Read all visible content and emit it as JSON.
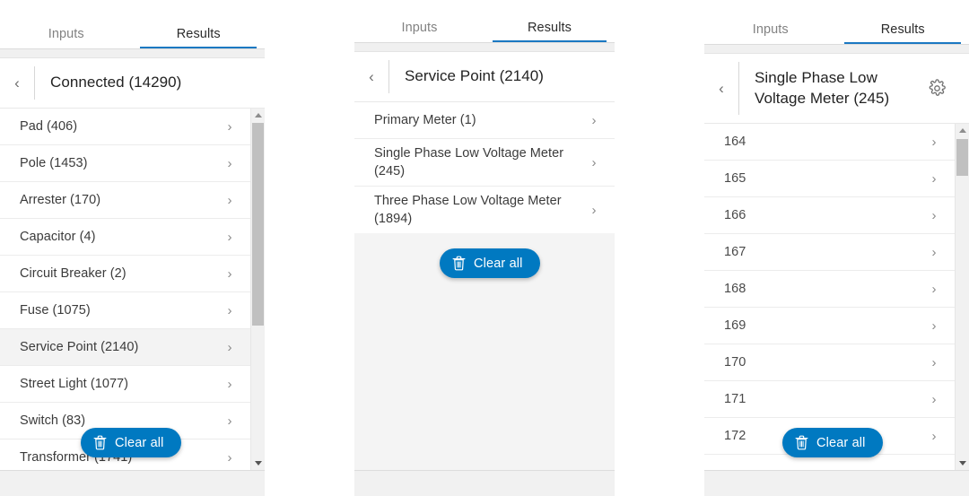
{
  "panels": [
    {
      "tabs": [
        {
          "label": "Inputs",
          "active": false
        },
        {
          "label": "Results",
          "active": true
        }
      ],
      "header": {
        "back_icon": "chevron-left-icon",
        "title": "Connected (14290)",
        "gear": false
      },
      "rows": [
        {
          "label": "Pad (406)",
          "selected": false
        },
        {
          "label": "Pole (1453)",
          "selected": false
        },
        {
          "label": "Arrester (170)",
          "selected": false
        },
        {
          "label": "Capacitor (4)",
          "selected": false
        },
        {
          "label": "Circuit Breaker (2)",
          "selected": false
        },
        {
          "label": "Fuse (1075)",
          "selected": false
        },
        {
          "label": "Service Point (2140)",
          "selected": true
        },
        {
          "label": "Street Light (1077)",
          "selected": false
        },
        {
          "label": "Switch (83)",
          "selected": false
        },
        {
          "label": "Transformer (1741)",
          "selected": false
        }
      ],
      "clear_all": {
        "label": "Clear all",
        "icon": "trash-icon"
      }
    },
    {
      "tabs": [
        {
          "label": "Inputs",
          "active": false
        },
        {
          "label": "Results",
          "active": true
        }
      ],
      "header": {
        "back_icon": "chevron-left-icon",
        "title": "Service Point (2140)",
        "gear": false
      },
      "rows": [
        {
          "label": "Primary Meter (1)",
          "selected": false
        },
        {
          "label": "Single Phase Low Voltage Meter (245)",
          "selected": false
        },
        {
          "label": "Three Phase Low Voltage Meter (1894)",
          "selected": false
        }
      ],
      "clear_all": {
        "label": "Clear all",
        "icon": "trash-icon"
      }
    },
    {
      "tabs": [
        {
          "label": "Inputs",
          "active": false
        },
        {
          "label": "Results",
          "active": true
        }
      ],
      "header": {
        "back_icon": "chevron-left-icon",
        "title": "Single Phase Low Voltage Meter (245)",
        "gear": true,
        "gear_icon": "gear-icon"
      },
      "rows": [
        {
          "label": "164",
          "selected": false
        },
        {
          "label": "165",
          "selected": false
        },
        {
          "label": "166",
          "selected": false
        },
        {
          "label": "167",
          "selected": false
        },
        {
          "label": "168",
          "selected": false
        },
        {
          "label": "169",
          "selected": false
        },
        {
          "label": "170",
          "selected": false
        },
        {
          "label": "171",
          "selected": false
        },
        {
          "label": "172",
          "selected": false
        }
      ],
      "clear_all": {
        "label": "Clear all",
        "icon": "trash-icon"
      }
    }
  ],
  "colors": {
    "accent_blue": "#0079c1",
    "tab_underline": "#1a78c2",
    "row_selected": "#f3f3f3",
    "panel_grey": "#f1f1f1",
    "text_primary": "#232323",
    "text_row": "#3b3b3b",
    "text_muted": "#828282"
  },
  "chevron_glyph": "›",
  "back_glyph": "‹"
}
